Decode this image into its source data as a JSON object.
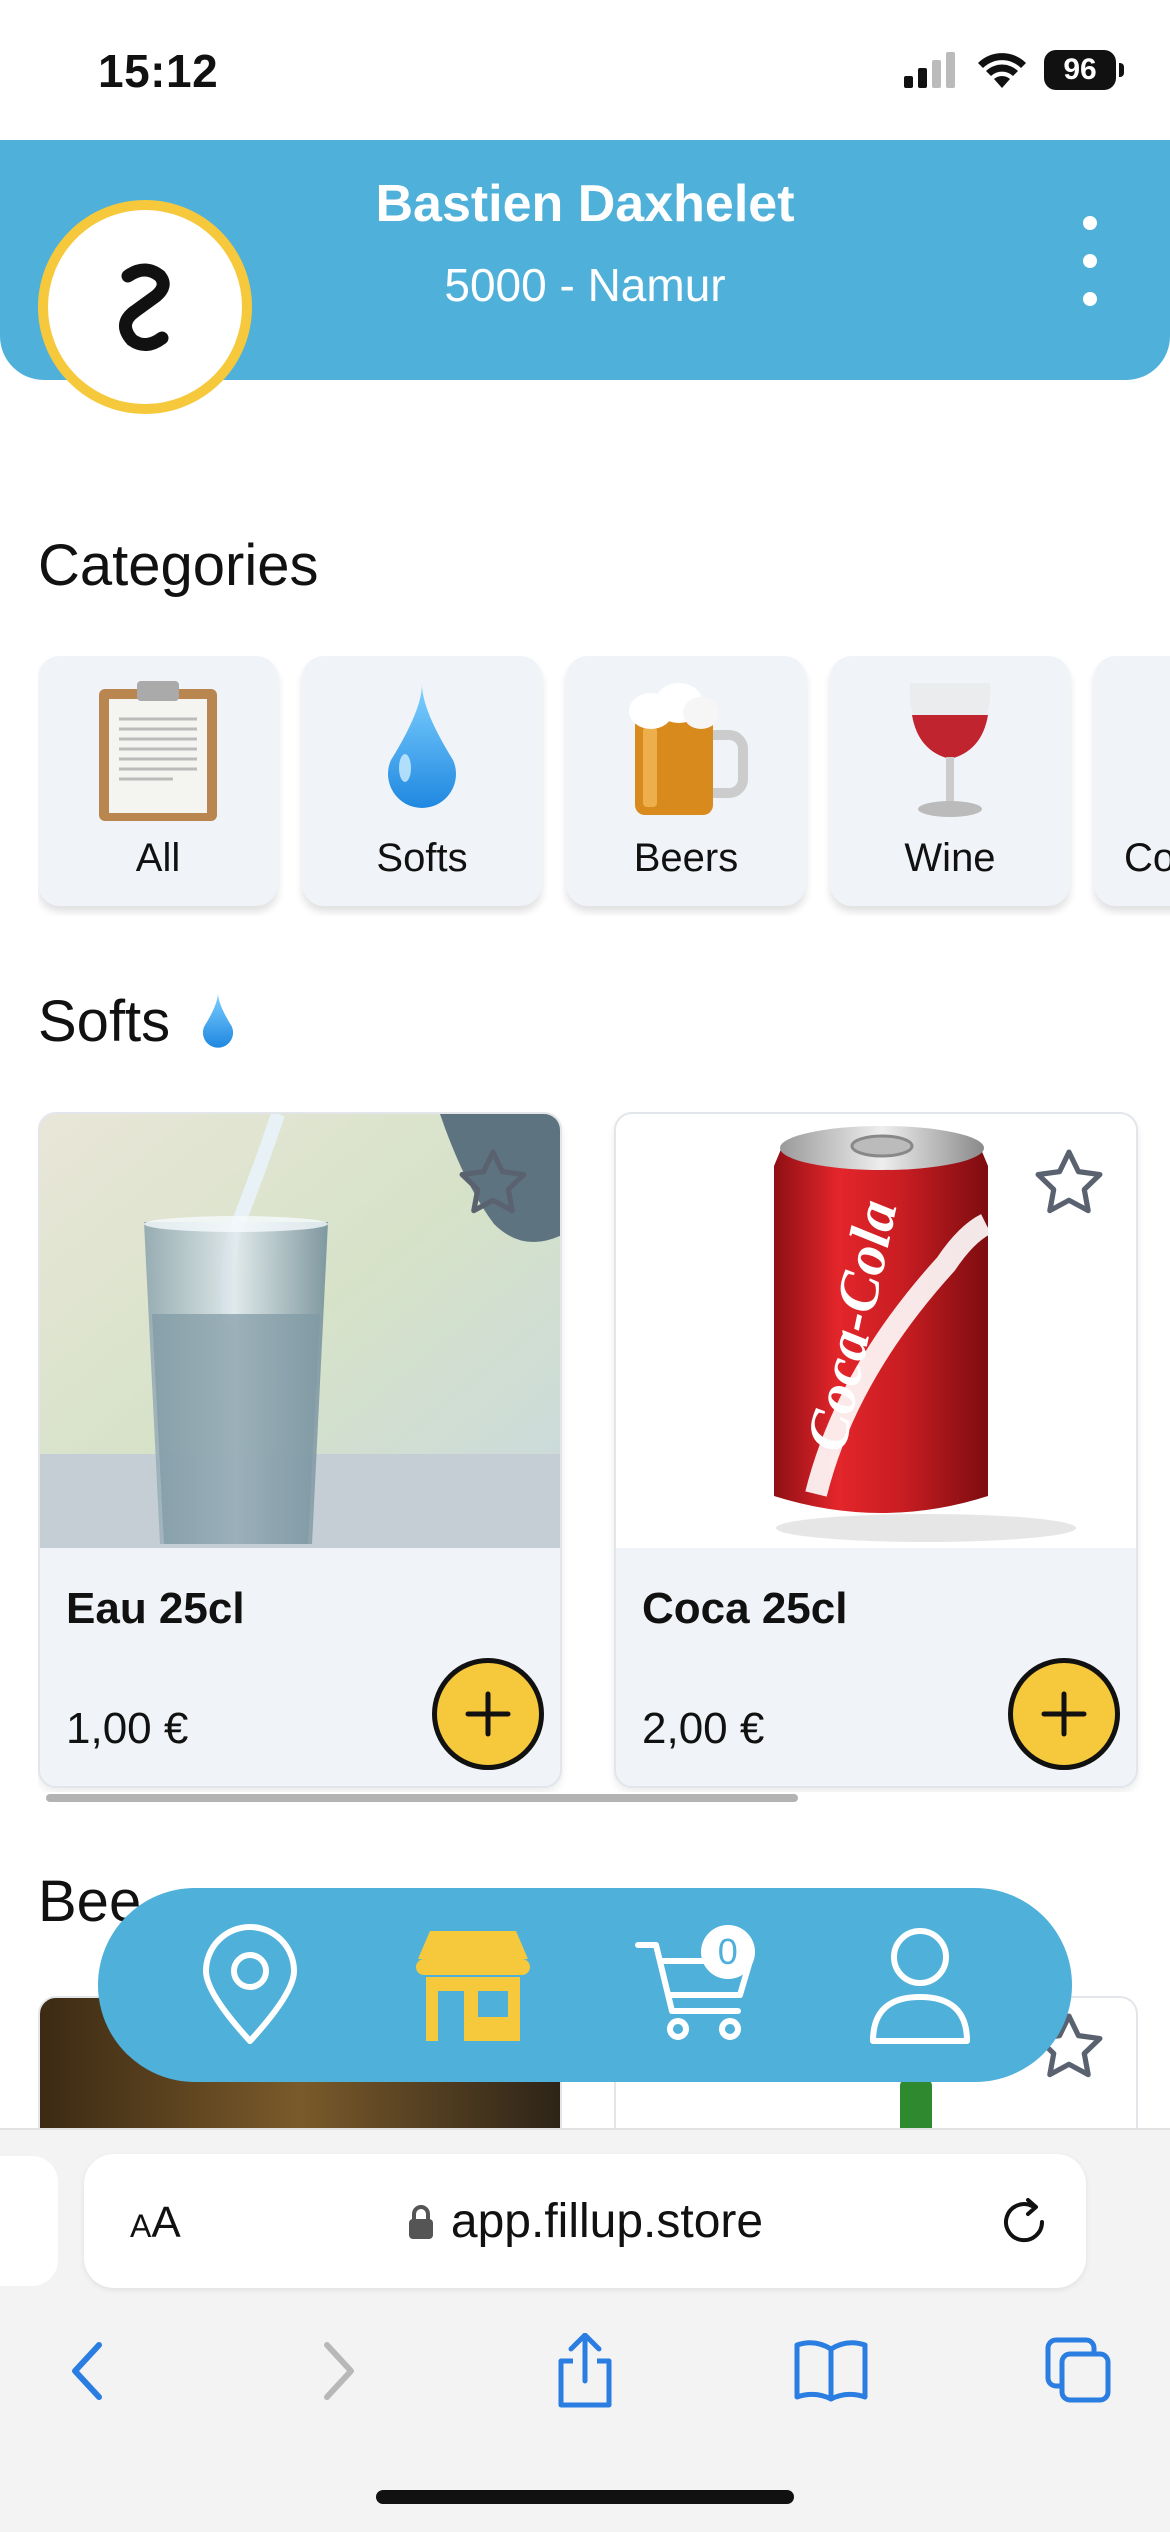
{
  "status_bar": {
    "time": "15:12",
    "battery": "96"
  },
  "header": {
    "name": "Bastien Daxhelet",
    "location": "5000 - Namur",
    "accent_color": "#4fb0d9",
    "avatar_ring_color": "#f6c93c"
  },
  "categories": {
    "title": "Categories",
    "items": [
      {
        "label": "All",
        "icon": "clipboard-icon"
      },
      {
        "label": "Softs",
        "icon": "droplet-icon"
      },
      {
        "label": "Beers",
        "icon": "beer-mug-icon"
      },
      {
        "label": "Wine",
        "icon": "wine-glass-icon"
      },
      {
        "label": "Co",
        "icon": "partial-category-icon"
      }
    ]
  },
  "softs": {
    "title": "Softs",
    "products": [
      {
        "name": "Eau 25cl",
        "price": "1,00 €"
      },
      {
        "name": "Coca 25cl",
        "price": "2,00 €"
      }
    ]
  },
  "beers": {
    "title": "Bee"
  },
  "bottom_nav": {
    "items": [
      "location-pin-icon",
      "shop-icon",
      "cart-icon",
      "user-icon"
    ],
    "cart_count": "0"
  },
  "browser": {
    "aa_small": "A",
    "aa_large": "A",
    "url": "app.fillup.store"
  }
}
